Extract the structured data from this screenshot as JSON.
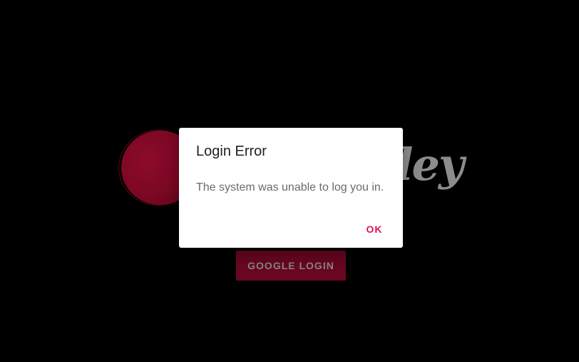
{
  "background": {
    "logo_word": "ley",
    "login_button_label": "GOOGLE LOGIN"
  },
  "dialog": {
    "title": "Login Error",
    "message": "The system was unable to log you in.",
    "ok_label": "OK"
  },
  "colors": {
    "page_background": "#000000",
    "brand": "#6e0723",
    "accent": "#e0115f",
    "dialog_background": "#ffffff"
  }
}
